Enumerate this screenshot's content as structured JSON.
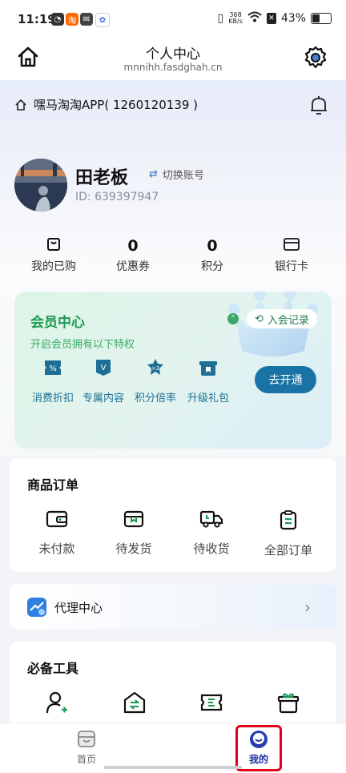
{
  "status_bar": {
    "time": "11:19",
    "speed_value": "368",
    "speed_unit": "KB/s",
    "battery_percent": "43%"
  },
  "header": {
    "title": "个人中心",
    "subtitle": "mnnihh.fasdghah.cn"
  },
  "app": {
    "name": "嘿马淘淘APP( 1260120139 )"
  },
  "profile": {
    "name": "田老板",
    "switch_label": "切换账号",
    "id_text": "ID: 639397947"
  },
  "stats": [
    {
      "value": "",
      "label": "我的已购",
      "icon": "purchase-icon"
    },
    {
      "value": "0",
      "label": "优惠券"
    },
    {
      "value": "0",
      "label": "积分"
    },
    {
      "value": "",
      "label": "银行卡",
      "icon": "bank-card-icon"
    }
  ],
  "vip": {
    "title": "会员中心",
    "subtitle": "开启会员拥有以下特权",
    "record_label": "入会记录",
    "open_label": "去开通",
    "perks": [
      {
        "label": "消费折扣",
        "icon": "discount-icon",
        "mark": "%"
      },
      {
        "label": "专属内容",
        "icon": "exclusive-icon",
        "mark": "V"
      },
      {
        "label": "积分倍率",
        "icon": "points-multiplier-icon",
        "mark": "×2"
      },
      {
        "label": "升级礼包",
        "icon": "gift-pack-icon",
        "mark": ""
      }
    ]
  },
  "orders": {
    "title": "商品订单",
    "items": [
      {
        "label": "未付款",
        "icon": "wallet-icon"
      },
      {
        "label": "待发货",
        "icon": "package-icon"
      },
      {
        "label": "待收货",
        "icon": "truck-icon"
      },
      {
        "label": "全部订单",
        "icon": "clipboard-icon"
      }
    ]
  },
  "agent": {
    "label": "代理中心"
  },
  "tools": {
    "title": "必备工具"
  },
  "nav": {
    "home": "首页",
    "mine": "我的"
  },
  "colors": {
    "accent_green": "#1c9a52",
    "accent_blue": "#1a73a5",
    "highlight_red": "#e0001b"
  }
}
